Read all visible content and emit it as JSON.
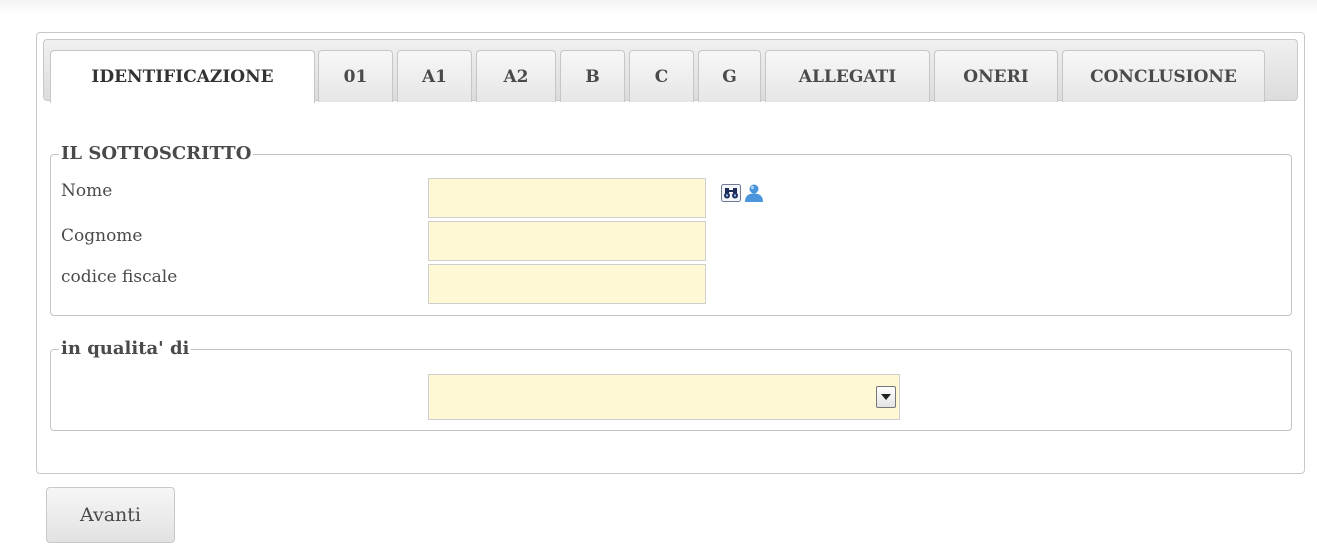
{
  "tabs": [
    {
      "label": "IDENTIFICAZIONE",
      "active": true
    },
    {
      "label": "01",
      "active": false
    },
    {
      "label": "A1",
      "active": false
    },
    {
      "label": "A2",
      "active": false
    },
    {
      "label": "B",
      "active": false
    },
    {
      "label": "C",
      "active": false
    },
    {
      "label": "G",
      "active": false
    },
    {
      "label": "ALLEGATI",
      "active": false
    },
    {
      "label": "ONERI",
      "active": false
    },
    {
      "label": "CONCLUSIONE",
      "active": false
    }
  ],
  "sottoscritto": {
    "legend": "IL SOTTOSCRITTO",
    "nome_label": "Nome",
    "nome_value": "",
    "cognome_label": "Cognome",
    "cognome_value": "",
    "codice_fiscale_label": "codice fiscale",
    "codice_fiscale_value": "",
    "search_icon": "binoculars-icon",
    "user_icon": "user-icon"
  },
  "qualita": {
    "legend": "in qualita' di",
    "selected": ""
  },
  "actions": {
    "next_label": "Avanti"
  },
  "colors": {
    "input_bg": "#fff8d4",
    "border": "#c3c3c3"
  }
}
